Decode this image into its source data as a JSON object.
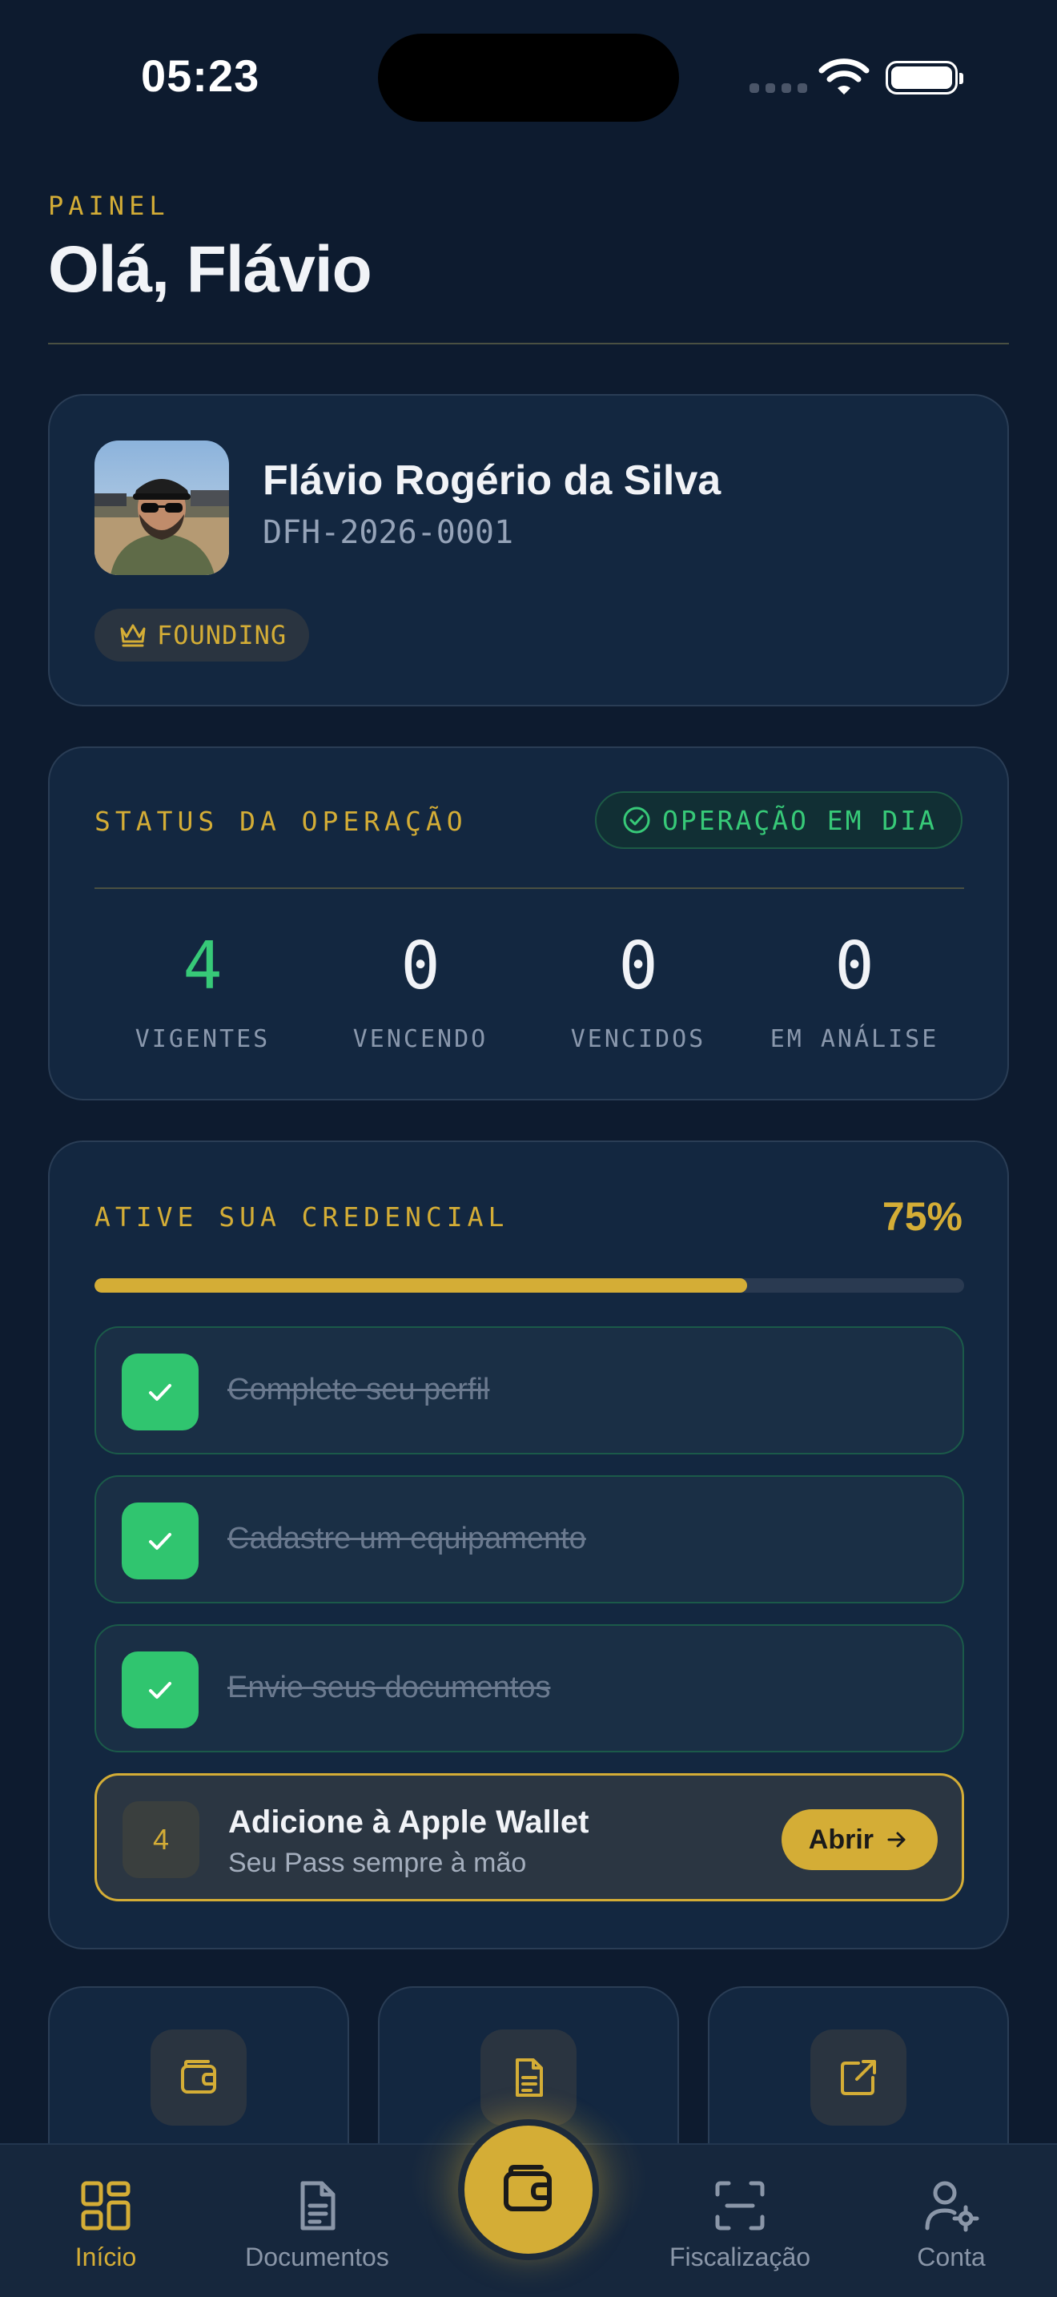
{
  "status_bar": {
    "time": "05:23"
  },
  "header": {
    "eyebrow": "PAINEL",
    "greeting": "Olá, Flávio"
  },
  "profile": {
    "name": "Flávio Rogério da Silva",
    "id": "DFH-2026-0001",
    "badge": "FOUNDING"
  },
  "operation_status": {
    "title": "STATUS DA OPERAÇÃO",
    "pill": "OPERAÇÃO EM DIA",
    "stats": [
      {
        "value": "4",
        "label": "VIGENTES"
      },
      {
        "value": "0",
        "label": "VENCENDO"
      },
      {
        "value": "0",
        "label": "VENCIDOS"
      },
      {
        "value": "0",
        "label": "EM ANÁLISE"
      }
    ]
  },
  "credential": {
    "title": "ATIVE SUA CREDENCIAL",
    "percent_label": "75%",
    "progress": 0.75,
    "steps": [
      {
        "label": "Complete seu perfil",
        "done": true
      },
      {
        "label": "Cadastre um equipamento",
        "done": true
      },
      {
        "label": "Envie seus documentos",
        "done": true
      }
    ],
    "next_step": {
      "number": "4",
      "title": "Adicione à Apple Wallet",
      "subtitle": "Seu Pass sempre à mão",
      "button": "Abrir"
    }
  },
  "quick_actions": [
    {
      "icon": "wallet-icon"
    },
    {
      "icon": "document-icon"
    },
    {
      "icon": "external-link-icon"
    }
  ],
  "tab_bar": {
    "tabs": [
      {
        "label": "Início",
        "icon": "grid-icon",
        "active": true
      },
      {
        "label": "Documentos",
        "icon": "document-icon",
        "active": false
      },
      {
        "label": "Fiscalização",
        "icon": "scan-icon",
        "active": false
      },
      {
        "label": "Conta",
        "icon": "user-settings-icon",
        "active": false
      }
    ],
    "center_icon": "wallet-icon"
  },
  "colors": {
    "background": "#0d1b2f",
    "card": "#132740",
    "accent": "#d4ad36",
    "success": "#37c978",
    "muted": "#8a98ad"
  }
}
